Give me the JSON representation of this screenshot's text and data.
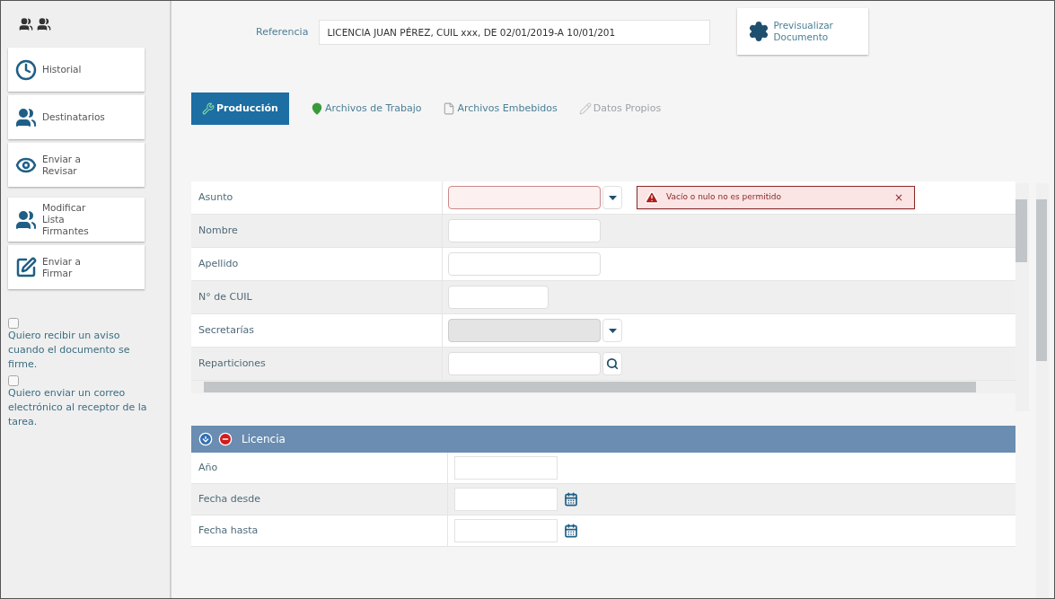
{
  "sidebar": {
    "buttons": [
      {
        "kind": "clock",
        "label": "Historial"
      },
      {
        "kind": "group",
        "label": "Destinatarios"
      },
      {
        "kind": "eye",
        "label": "Enviar a Revisar"
      },
      {
        "kind": "group",
        "label": "Modificar Lista Firmantes"
      },
      {
        "kind": "sign",
        "label": "Enviar a Firmar"
      }
    ],
    "options": [
      {
        "checked": false,
        "label": "Quiero recibir un aviso cuando el documento se firme."
      },
      {
        "checked": false,
        "label": "Quiero enviar un correo electrónico al receptor de la tarea."
      }
    ]
  },
  "reference": {
    "label": "Referencia",
    "value": "LICENCIA JUAN PÉREZ, CUIL xxx, DE 02/01/2019-A 10/01/201"
  },
  "preview_button": "Previsualizar Documento",
  "tabs": [
    {
      "kind": "tools",
      "label": "Producción",
      "selected": true,
      "disabled": false
    },
    {
      "kind": "pin",
      "label": "Archivos de Trabajo",
      "selected": false,
      "disabled": false
    },
    {
      "kind": "file",
      "label": "Archivos Embebidos",
      "selected": false,
      "disabled": false
    },
    {
      "kind": "pen",
      "label": "Datos Propios",
      "selected": false,
      "disabled": true
    }
  ],
  "form": {
    "rows": [
      {
        "label": "Asunto",
        "kind": "select",
        "error": true,
        "disabled": false
      },
      {
        "label": "Nombre",
        "kind": "text",
        "error": false,
        "disabled": false
      },
      {
        "label": "Apellido",
        "kind": "text",
        "error": false,
        "disabled": false
      },
      {
        "label": "N° de CUIL",
        "kind": "number",
        "error": false,
        "disabled": false
      },
      {
        "label": "Secretarías",
        "kind": "select",
        "error": false,
        "disabled": true
      },
      {
        "label": "Reparticiones",
        "kind": "search",
        "error": false,
        "disabled": false
      }
    ],
    "error_message": "Vacío o nulo no es permitido",
    "error_close": "×"
  },
  "section": {
    "title": "Licencia",
    "rows": [
      {
        "label": "Año",
        "kind": "text"
      },
      {
        "label": "Fecha desde",
        "kind": "date"
      },
      {
        "label": "Fecha hasta",
        "kind": "date"
      }
    ]
  }
}
